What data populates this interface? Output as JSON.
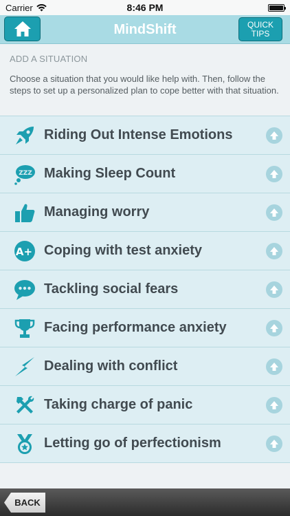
{
  "status": {
    "carrier": "Carrier",
    "time": "8:46 PM"
  },
  "nav": {
    "title": "MindShift",
    "tips_line1": "QUICK",
    "tips_line2": "TIPS"
  },
  "header": {
    "section_title": "ADD A SITUATION",
    "intro": "Choose a situation that you would like help with. Then, follow the steps to set up a personalized plan to cope better with that situation."
  },
  "items": [
    {
      "label": "Riding Out Intense Emotions",
      "icon": "rocket-icon"
    },
    {
      "label": "Making Sleep Count",
      "icon": "sleep-bubble-icon"
    },
    {
      "label": "Managing worry",
      "icon": "thumbs-up-icon"
    },
    {
      "label": "Coping with test anxiety",
      "icon": "a-plus-icon"
    },
    {
      "label": "Tackling social fears",
      "icon": "chat-bubble-icon"
    },
    {
      "label": "Facing performance anxiety",
      "icon": "trophy-icon"
    },
    {
      "label": "Dealing with conflict",
      "icon": "lightning-icon"
    },
    {
      "label": "Taking charge of panic",
      "icon": "tools-icon"
    },
    {
      "label": "Letting go of perfectionism",
      "icon": "medal-icon"
    }
  ],
  "toolbar": {
    "back_label": "BACK"
  },
  "colors": {
    "accent": "#1c9fb0",
    "navbar": "#a9dbe4",
    "row": "#ddeef3",
    "text": "#414a50"
  }
}
